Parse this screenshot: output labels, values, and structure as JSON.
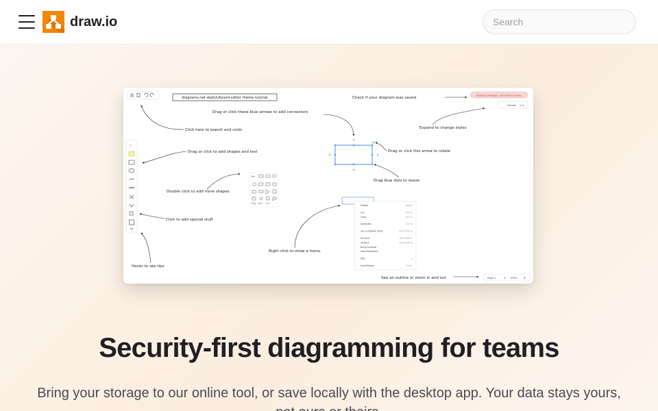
{
  "header": {
    "logo_text": "draw.io",
    "search_placeholder": "Search",
    "brand_color": "#f08705"
  },
  "screenshot": {
    "title_box": "diagrams.net sketch/board editor theme tutorial",
    "unsaved_badge": "Unsaved changes. Click here to save.",
    "format_label": "Format",
    "page_label": "Page-1",
    "zoom_label": "100%",
    "annotations": {
      "export_undo": "Click here to export and undo",
      "arrows": "Drag or click these blue arrows to add connectors",
      "saved": "Check if your diagram was saved",
      "styles": "Expand to change styles",
      "shapes_text": "Drag or click to add shapes and text",
      "rotate": "Drag or click this arrow to rotate",
      "resize": "Drag blue dots to resize",
      "more_shapes": "Double click to add more shapes",
      "special": "Click to add special stuff",
      "menu": "Right click to show a menu",
      "tips": "Hover to see tips",
      "outline": "See an outline or zoom in and out"
    },
    "context_menu": [
      [
        "Delete",
        "Delete"
      ],
      [
        "Cut",
        "Ctrl+X"
      ],
      [
        "Copy",
        "Ctrl+C"
      ],
      [
        "Duplicate",
        "Ctrl+D"
      ],
      [
        "Set as Default Style",
        "Ctrl+Shift+D"
      ],
      [
        "To Front",
        "Ctrl+Shift+F"
      ],
      [
        "To Back",
        "Ctrl+Shift+B"
      ],
      [
        "Bring Forward",
        ""
      ],
      [
        "Send Backward",
        ""
      ],
      [
        "Edit",
        "▸"
      ],
      [
        "Lock/Unlock",
        "Ctrl+L"
      ]
    ],
    "shape_palette_label": "Text"
  },
  "hero": {
    "headline": "Security-first diagramming for teams",
    "subtext": "Bring your storage to our online tool, or save locally with the desktop app. Your data stays yours, not ours or theirs."
  }
}
